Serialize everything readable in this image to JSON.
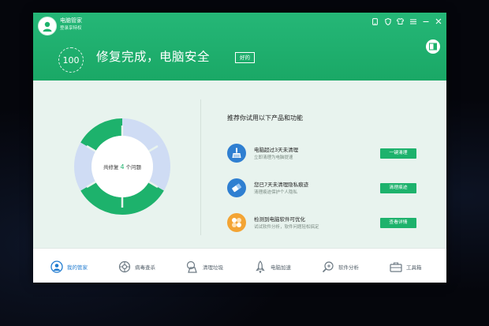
{
  "app": {
    "title": "电脑管家",
    "subtitle": "登录享特权"
  },
  "status": {
    "score": "100",
    "title": "修复完成，电脑安全",
    "badge": "好的"
  },
  "donut": {
    "prefix": "共修复",
    "count": "4",
    "suffix": "个问题"
  },
  "recommend": {
    "title": "推荐你试用以下产品和功能",
    "items": [
      {
        "main": "电脑超过3天未清理",
        "desc": "立即清理为电脑提速",
        "button": "一键清理",
        "icon": "broom-icon"
      },
      {
        "main": "您已7天未清理隐私痕迹",
        "desc": "清理痕迹保护个人隐私",
        "button": "清理痕迹",
        "icon": "eraser-icon"
      },
      {
        "main": "检测到电脑软件可优化",
        "desc": "试试软件分析，软件问题轻松搞定",
        "button": "查看详情",
        "icon": "software-analysis-icon"
      }
    ]
  },
  "nav": [
    {
      "label": "我的管家",
      "icon": "butler-icon",
      "active": true
    },
    {
      "label": "病毒查杀",
      "icon": "virus-scan-icon"
    },
    {
      "label": "清理垃圾",
      "icon": "cleanup-icon"
    },
    {
      "label": "电脑加速",
      "icon": "rocket-icon"
    },
    {
      "label": "软件分析",
      "icon": "software-search-icon"
    },
    {
      "label": "工具箱",
      "icon": "toolbox-icon"
    }
  ],
  "colors": {
    "brand_green": "#1db26c",
    "donut_light": "#cfdcf4",
    "active_blue": "#1f7bd0"
  }
}
